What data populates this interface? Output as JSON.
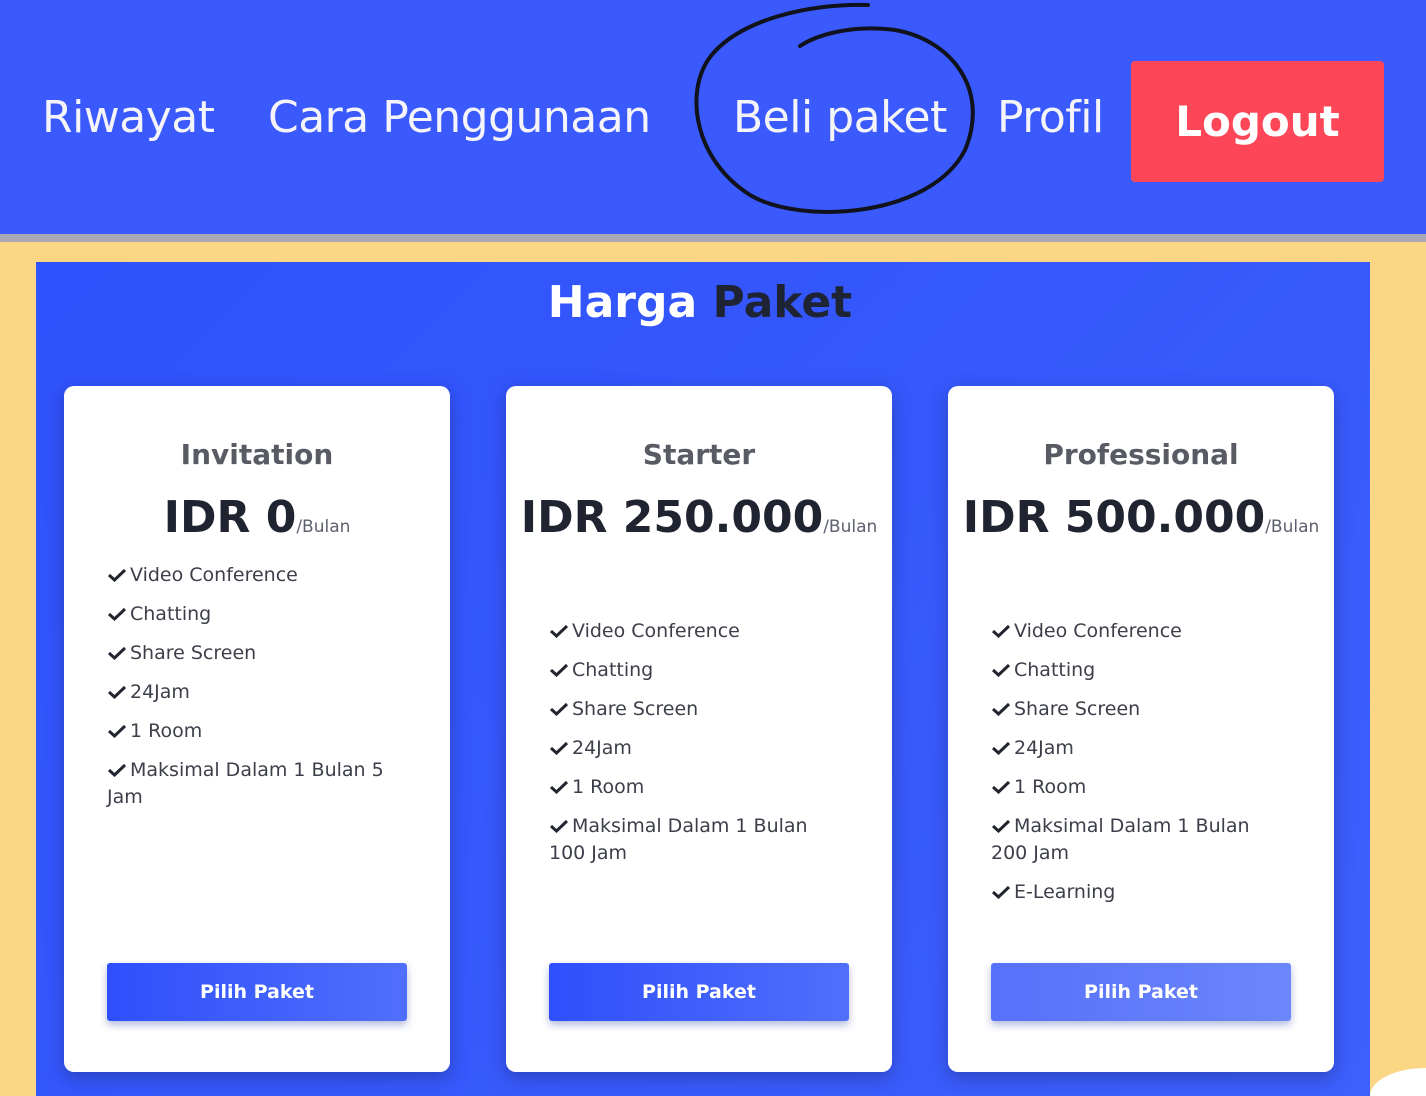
{
  "nav": {
    "items": [
      {
        "label": "Riwayat"
      },
      {
        "label": "Cara Penggunaan"
      },
      {
        "label": "Beli paket"
      },
      {
        "label": "Profil"
      }
    ],
    "logout_label": "Logout",
    "accent_color": "#3a5afe",
    "logout_color": "#fd4759"
  },
  "pricing": {
    "title_part1": "Harga",
    "title_part2": "Paket",
    "plans": [
      {
        "name": "Invitation",
        "price": "IDR 0",
        "period": "/Bulan",
        "features": [
          "Video Conference",
          "Chatting",
          "Share Screen",
          "24Jam",
          "1 Room",
          "Maksimal Dalam 1 Bulan 5 Jam"
        ],
        "button_label": "Pilih Paket"
      },
      {
        "name": "Starter",
        "price": "IDR 250.000",
        "period": "/Bulan",
        "features": [
          "Video Conference",
          "Chatting",
          "Share Screen",
          "24Jam",
          "1 Room",
          "Maksimal Dalam 1 Bulan 100 Jam"
        ],
        "button_label": "Pilih Paket"
      },
      {
        "name": "Professional",
        "price": "IDR 500.000",
        "period": "/Bulan",
        "features": [
          "Video Conference",
          "Chatting",
          "Share Screen",
          "24Jam",
          "1 Room",
          "Maksimal Dalam 1 Bulan 200 Jam",
          "E-Learning"
        ],
        "button_label": "Pilih Paket"
      }
    ],
    "background_color": "#fbd685",
    "check_icon": "check-icon"
  }
}
